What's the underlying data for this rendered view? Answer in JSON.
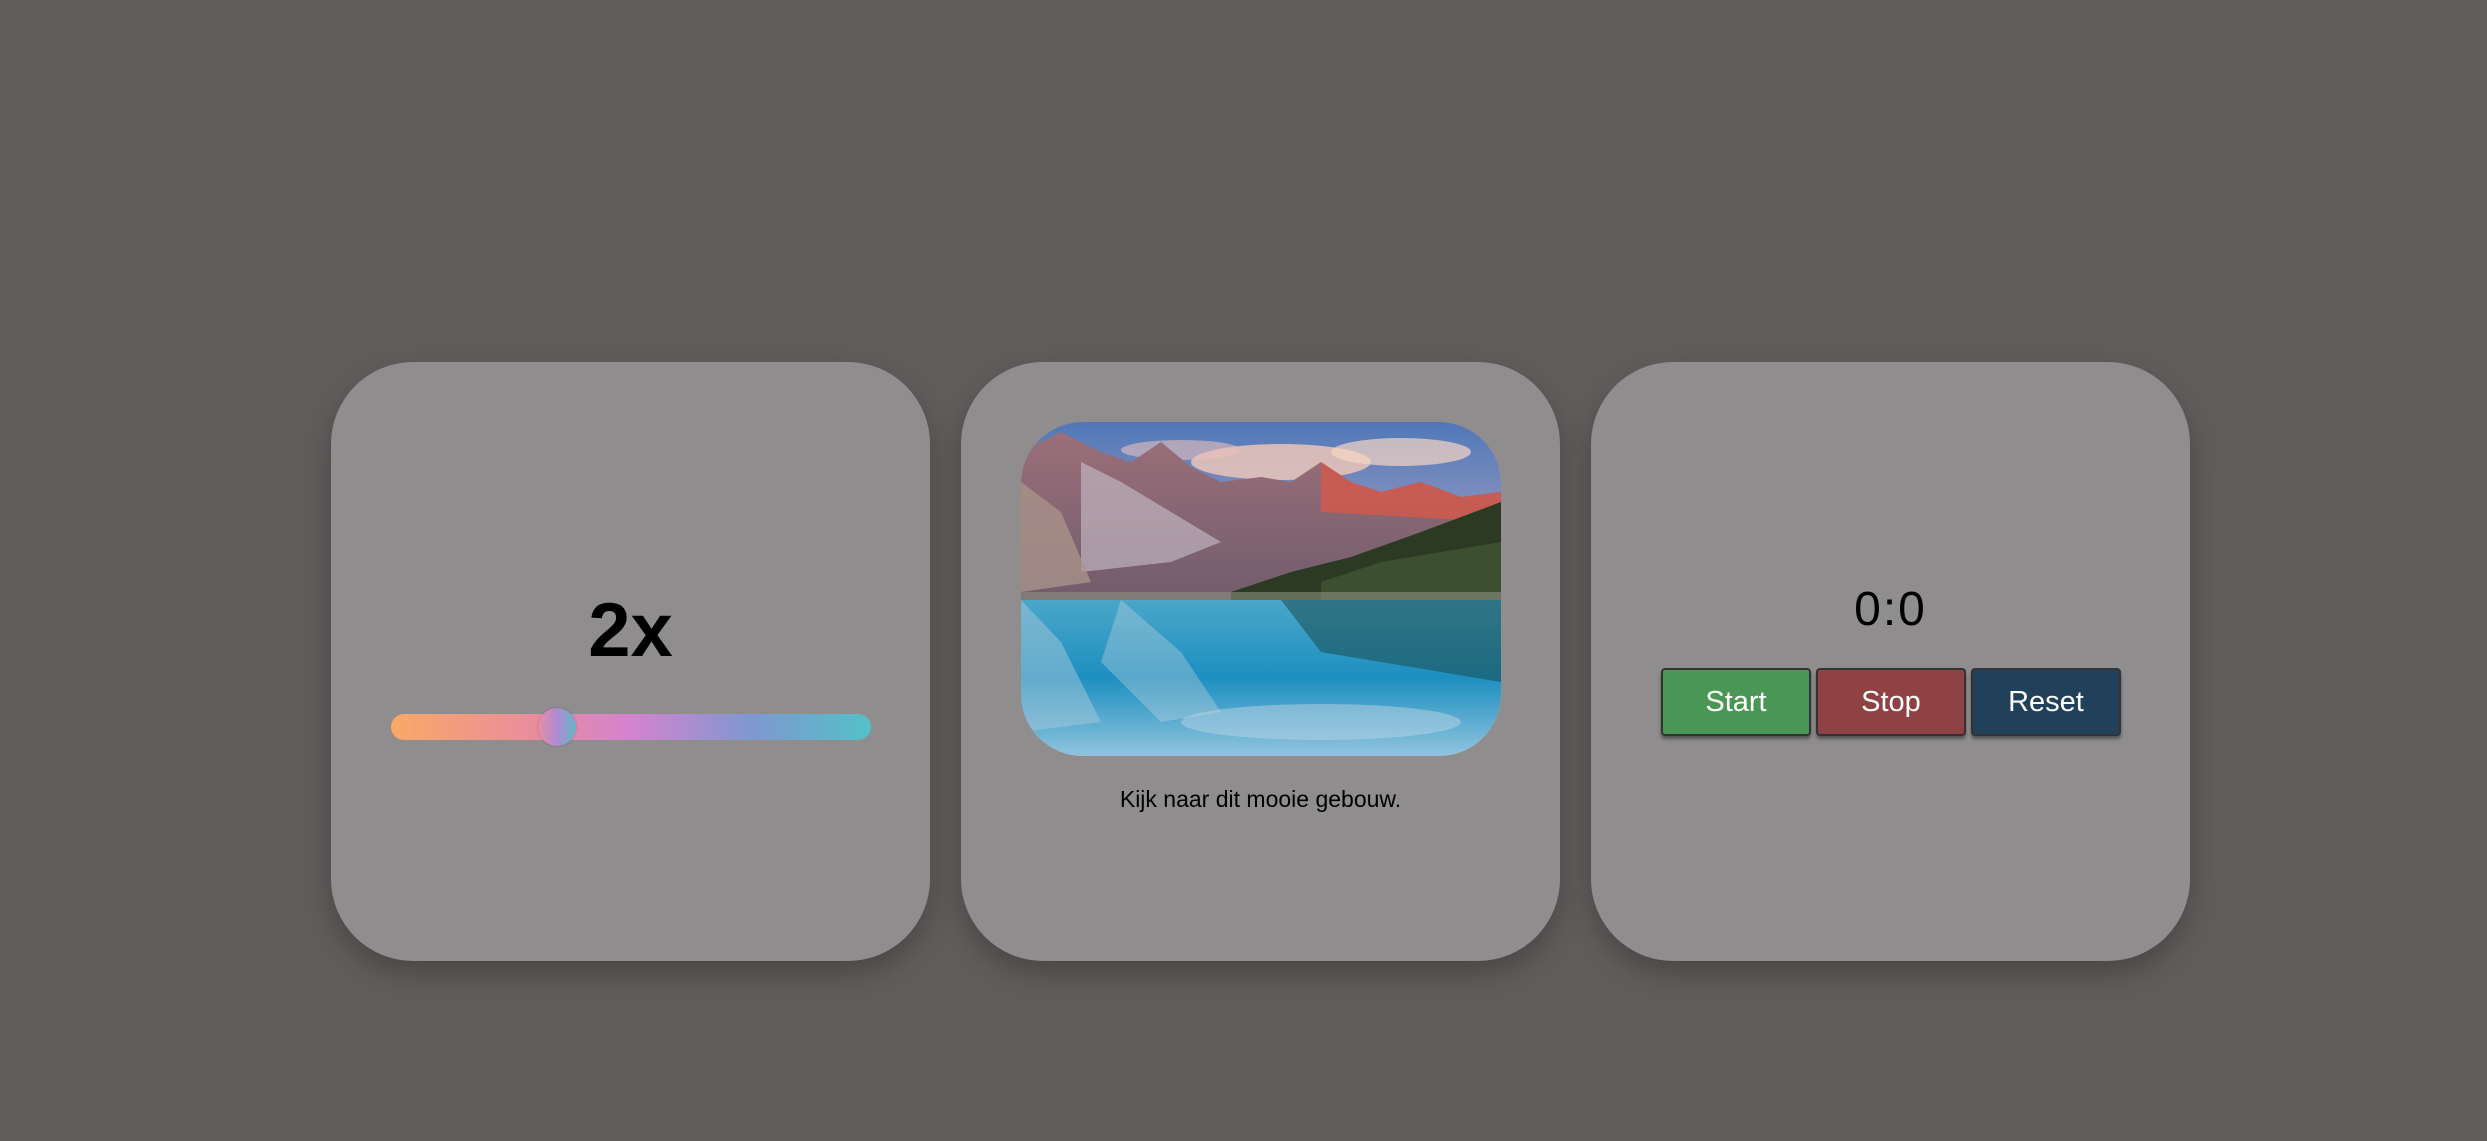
{
  "speed_card": {
    "speed_label": "2x",
    "slider": {
      "value_fraction": 0.345
    }
  },
  "image_card": {
    "caption": "Kijk naar dit mooie gebouw."
  },
  "timer_card": {
    "time_display": "0:0",
    "start_label": "Start",
    "stop_label": "Stop",
    "reset_label": "Reset"
  },
  "colors": {
    "background": "#615d5c",
    "card": "#8f8d8e",
    "start_button": "#4a9654",
    "stop_button": "#8e4243",
    "reset_button": "#21405a"
  }
}
